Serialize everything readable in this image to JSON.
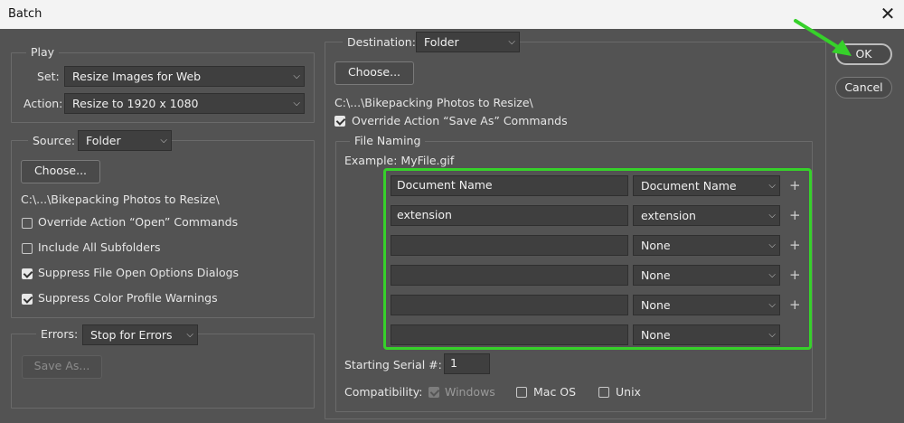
{
  "window": {
    "title": "Batch",
    "close_glyph": "✕"
  },
  "play": {
    "legend": "Play",
    "set_label": "Set:",
    "set_value": "Resize Images for Web",
    "action_label": "Action:",
    "action_value": "Resize to 1920 x 1080"
  },
  "source": {
    "label": "Source:",
    "value": "Folder",
    "choose_label": "Choose...",
    "path": "C:\\...\\Bikepacking Photos to Resize\\",
    "options": [
      {
        "label": "Override Action “Open” Commands",
        "checked": false
      },
      {
        "label": "Include All Subfolders",
        "checked": false
      },
      {
        "label": "Suppress File Open Options Dialogs",
        "checked": true
      },
      {
        "label": "Suppress Color Profile Warnings",
        "checked": true
      }
    ]
  },
  "errors": {
    "label": "Errors:",
    "value": "Stop for Errors",
    "save_as_label": "Save As..."
  },
  "destination": {
    "label": "Destination:",
    "value": "Folder",
    "choose_label": "Choose...",
    "path": "C:\\...\\Bikepacking Photos to Resize\\",
    "override_label": "Override Action “Save As” Commands",
    "override_checked": true
  },
  "file_naming": {
    "legend": "File Naming",
    "example": "Example: MyFile.gif",
    "rows": [
      {
        "text": "Document Name",
        "select": "Document Name"
      },
      {
        "text": "extension",
        "select": "extension"
      },
      {
        "text": "",
        "select": "None"
      },
      {
        "text": "",
        "select": "None"
      },
      {
        "text": "",
        "select": "None"
      },
      {
        "text": "",
        "select": "None"
      }
    ],
    "plus_glyph": "+",
    "serial_label": "Starting Serial #:",
    "serial_value": "1",
    "compat_label": "Compatibility:",
    "compat": [
      {
        "label": "Windows",
        "checked": true,
        "disabled": true
      },
      {
        "label": "Mac OS",
        "checked": false,
        "disabled": false
      },
      {
        "label": "Unix",
        "checked": false,
        "disabled": false
      }
    ]
  },
  "actions": {
    "ok_label": "OK",
    "cancel_label": "Cancel"
  },
  "colors": {
    "highlight": "#36d12a",
    "background": "#535353"
  }
}
